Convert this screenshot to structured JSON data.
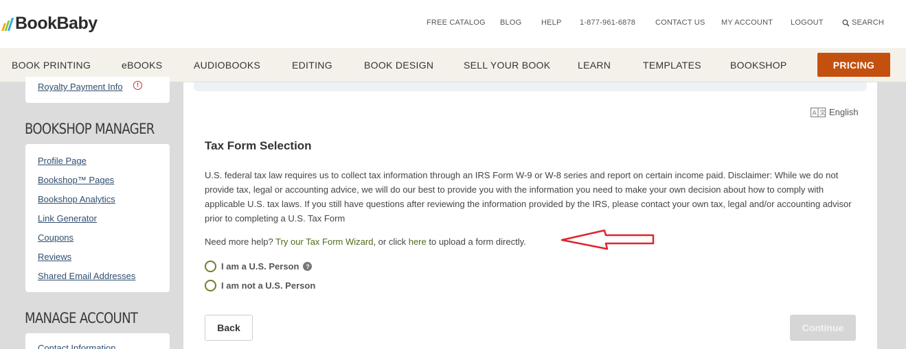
{
  "brand": {
    "name": "BookBaby",
    "bar_colors": [
      "#f2a900",
      "#8cc63f",
      "#29a8e0"
    ]
  },
  "utility_nav": {
    "free_catalog": "FREE CATALOG",
    "blog": "BLOG",
    "help": "HELP",
    "phone": "1-877-961-6878",
    "contact_us": "CONTACT US",
    "my_account": "MY ACCOUNT",
    "logout": "LOGOUT",
    "search": "SEARCH"
  },
  "main_nav": {
    "items": [
      "BOOK PRINTING",
      "eBOOKS",
      "AUDIOBOOKS",
      "EDITING",
      "BOOK DESIGN",
      "SELL YOUR BOOK",
      "LEARN",
      "TEMPLATES",
      "BOOKSHOP"
    ],
    "pricing": "PRICING"
  },
  "sidebar": {
    "royalty_link": "Royalty Payment Info",
    "bookshop_heading": "BOOKSHOP MANAGER",
    "bookshop_links": [
      "Profile Page",
      "Bookshop™ Pages",
      "Bookshop Analytics",
      "Link Generator",
      "Coupons",
      "Reviews",
      "Shared Email Addresses"
    ],
    "manage_heading": "MANAGE ACCOUNT",
    "manage_links": [
      "Contact Information"
    ]
  },
  "content": {
    "language": "English",
    "title": "Tax Form Selection",
    "paragraph": "U.S. federal tax law requires us to collect tax information through an IRS Form W-9 or W-8 series and report on certain income paid. Disclaimer: While we do not provide tax, legal or accounting advice, we will do our best to provide you with the information you need to make your own decision about how to comply with applicable U.S. tax laws. If you still have questions after reviewing the information provided by the IRS, please contact your own tax, legal and/or accounting advisor prior to completing a U.S. Tax Form",
    "help_prefix": "Need more help?",
    "wizard_link": "Try our Tax Form Wizard",
    "help_middle": ", or click",
    "here_link": "here",
    "help_suffix": "to upload a form directly.",
    "radio_us": "I am a U.S. Person",
    "radio_not_us": "I am not a U.S. Person",
    "back": "Back",
    "continue": "Continue"
  },
  "colors": {
    "pricing_bg": "#c4500f",
    "link_green": "#4f6b1c",
    "arrow_red": "#e0242b"
  }
}
